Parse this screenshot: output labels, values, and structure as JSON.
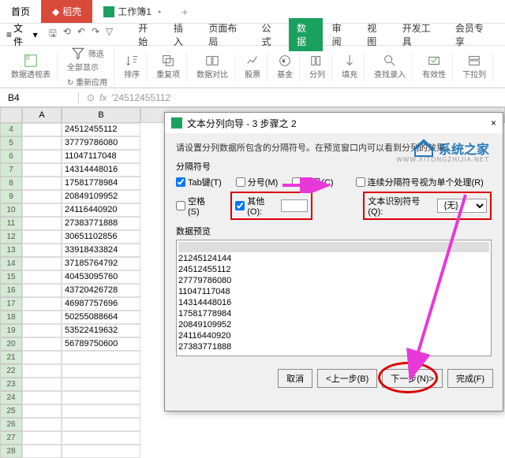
{
  "tabs": {
    "home": "首页",
    "red": "稻壳",
    "green": "工作簿1"
  },
  "menubar": {
    "file": "文件"
  },
  "menu_tabs": [
    "开始",
    "插入",
    "页面布局",
    "公式",
    "数据",
    "审阅",
    "视图",
    "开发工具",
    "会员专享"
  ],
  "ribbon": {
    "pivot": "数据透视表",
    "filter": "筛选",
    "showall": "全部显示",
    "reapply": "重新应用",
    "sort": "排序",
    "dup": "重复项",
    "compare": "数据对比",
    "stock": "股票",
    "fund": "基金",
    "split": "分列",
    "fill": "填充",
    "lookup": "查找录入",
    "valid": "有效性",
    "dropdown": "下拉列"
  },
  "cellref": {
    "name": "B4",
    "formula": "'24512455112"
  },
  "data_rows": [
    "24512455112",
    "37779786080",
    "11047117048",
    "14314448016",
    "17581778984",
    "20849109952",
    "24116440920",
    "27383771888",
    "30651102856",
    "33918433824",
    "37185764792",
    "40453095760",
    "43720426728",
    "46987757696",
    "50255088664",
    "53522419632",
    "56789750600"
  ],
  "row_start": 4,
  "dialog": {
    "title": "文本分列向导 - 3 步骤之 2",
    "desc": "请设置分列数据所包含的分隔符号。在预览窗口内可以看到分列的效果。",
    "section": "分隔符号",
    "tab_chk": "Tab键(T)",
    "semi": "分号(M)",
    "comma": "逗号(C)",
    "space": "空格(S)",
    "other": "其他(O):",
    "consec": "连续分隔符号视为单个处理(R)",
    "textq": "文本识别符号(Q):",
    "textq_val": "{无}",
    "preview_lbl": "数据预览",
    "preview": [
      "21245124144",
      "24512455112",
      "27779786080",
      "11047117048",
      "14314448016",
      "17581778984",
      "20849109952",
      "24116440920",
      "27383771888"
    ],
    "btn_cancel": "取消",
    "btn_back": "<上一步(B)",
    "btn_next": "下一步(N)>",
    "btn_finish": "完成(F)"
  },
  "watermark": {
    "text": "系统之家",
    "sub": "WWW.XITONGZHIJIA.NET"
  }
}
